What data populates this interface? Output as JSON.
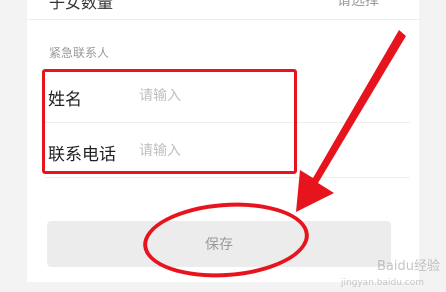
{
  "form": {
    "top_row": {
      "label": "子女数量",
      "value": "请选择"
    },
    "section_title": "紧急联系人",
    "fields": [
      {
        "label": "姓名",
        "placeholder": "请输入",
        "value": ""
      },
      {
        "label": "联系电话",
        "placeholder": "请输入",
        "value": ""
      }
    ],
    "save_label": "保存"
  },
  "annotations": {
    "color": "#e8141d",
    "items": [
      "highlight-box",
      "arrow",
      "ellipse"
    ]
  },
  "colors": {
    "accent": "#e8141d",
    "button_bg": "#ececec",
    "button_text": "#9a9a9a",
    "section_text": "#999999",
    "placeholder": "#c0c0c0"
  }
}
